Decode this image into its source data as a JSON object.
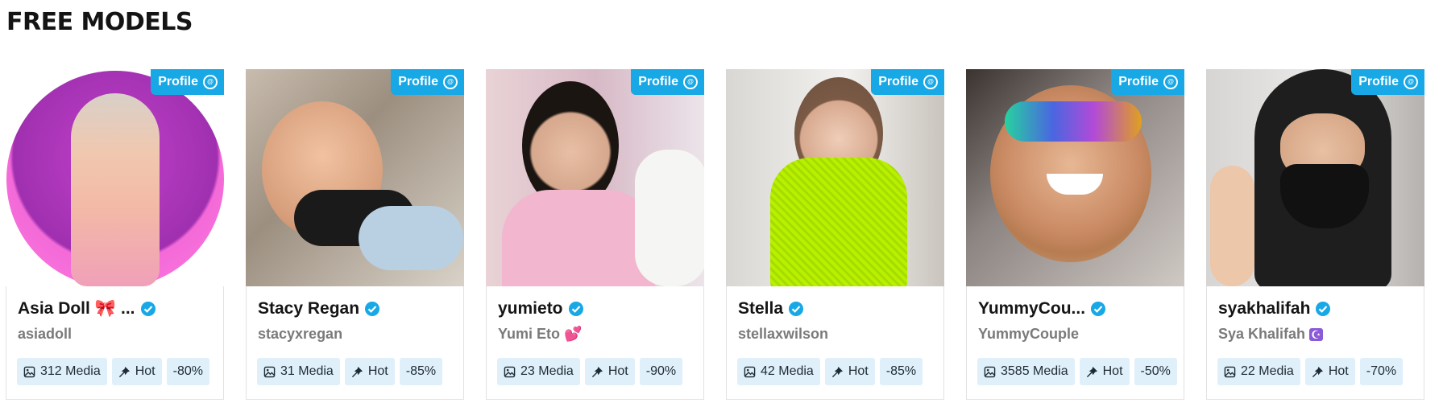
{
  "page": {
    "title": "FREE MODELS"
  },
  "profile_label": "Profile",
  "colors": {
    "accent": "#18a8e6",
    "tag_bg": "#dff0fb",
    "handle": "#7a7a7a"
  },
  "cards": [
    {
      "name": "Asia Doll",
      "emoji": "🎀",
      "ellipsis": "...",
      "handle": "asiadoll",
      "handle_emoji": "",
      "media": "312 Media",
      "hot": "Hot",
      "discount": "-80%"
    },
    {
      "name": "Stacy Regan",
      "emoji": "",
      "ellipsis": "",
      "handle": "stacyxregan",
      "handle_emoji": "",
      "media": "31 Media",
      "hot": "Hot",
      "discount": "-85%"
    },
    {
      "name": "yumieto",
      "emoji": "",
      "ellipsis": "",
      "handle": "Yumi Eto",
      "handle_emoji": "💕",
      "media": "23 Media",
      "hot": "Hot",
      "discount": "-90%"
    },
    {
      "name": "Stella",
      "emoji": "",
      "ellipsis": "",
      "handle": "stellaxwilson",
      "handle_emoji": "",
      "media": "42 Media",
      "hot": "Hot",
      "discount": "-85%"
    },
    {
      "name": "YummyCou...",
      "emoji": "",
      "ellipsis": "",
      "handle": "YummyCouple",
      "handle_emoji": "",
      "media": "3585 Media",
      "hot": "Hot",
      "discount": "-50%"
    },
    {
      "name": "syakhalifah",
      "emoji": "",
      "ellipsis": "",
      "handle": "Sya Khalifah",
      "handle_emoji": "☪",
      "media": "22 Media",
      "hot": "Hot",
      "discount": "-70%"
    }
  ]
}
